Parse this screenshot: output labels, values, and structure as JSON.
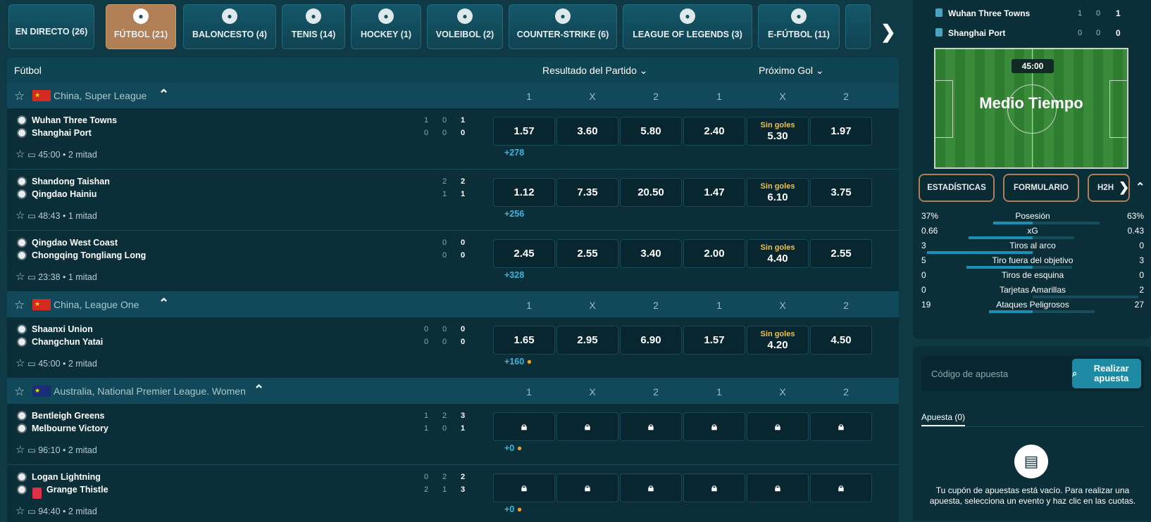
{
  "tabs": [
    {
      "label": "EN DIRECTO (26)",
      "icon": "live-icon"
    },
    {
      "label": "FÚTBOL (21)",
      "icon": "soccer-ball-icon",
      "active": true
    },
    {
      "label": "BALONCESTO (4)",
      "icon": "basketball-icon"
    },
    {
      "label": "TENIS (14)",
      "icon": "tennis-ball-icon"
    },
    {
      "label": "HOCKEY (1)",
      "icon": "hockey-stick-icon"
    },
    {
      "label": "VOLEIBOL (2)",
      "icon": "volleyball-icon"
    },
    {
      "label": "COUNTER-STRIKE (6)",
      "icon": "counter-strike-icon"
    },
    {
      "label": "LEAGUE OF LEGENDS (3)",
      "icon": "league-of-legends-icon"
    },
    {
      "label": "E-FÚTBOL (11)",
      "icon": "efootball-icon"
    }
  ],
  "header": {
    "sport": "Fútbol",
    "market1": "Resultado del Partido",
    "market2": "Próximo Gol"
  },
  "cols": [
    "1",
    "X",
    "2",
    "1",
    "X",
    "2"
  ],
  "leagues": [
    {
      "name": "China, Super League",
      "flag": "cn",
      "events": [
        {
          "home": "Wuhan Three Towns",
          "away": "Shanghai Port",
          "hs": [
            "1",
            "0",
            "1"
          ],
          "as": [
            "0",
            "0",
            "0"
          ],
          "time": "45:00 • 2 mitad",
          "more": "+278",
          "odds": [
            "1.57",
            "3.60",
            "5.80",
            "2.40",
            "5.30",
            "1.97"
          ],
          "sg": "Sin goles"
        },
        {
          "home": "Shandong Taishan",
          "away": "Qingdao Hainiu",
          "hs": [
            "2",
            "2"
          ],
          "as": [
            "1",
            "1"
          ],
          "time": "48:43 • 1 mitad",
          "more": "+256",
          "odds": [
            "1.12",
            "7.35",
            "20.50",
            "1.47",
            "6.10",
            "3.75"
          ],
          "sg": "Sin goles"
        },
        {
          "home": "Qingdao West Coast",
          "away": "Chongqing Tongliang Long",
          "hs": [
            "0",
            "0"
          ],
          "as": [
            "0",
            "0"
          ],
          "time": "23:38 • 1 mitad",
          "more": "+328",
          "odds": [
            "2.45",
            "2.55",
            "3.40",
            "2.00",
            "4.40",
            "2.55"
          ],
          "sg": "Sin goles"
        }
      ]
    },
    {
      "name": "China, League One",
      "flag": "cn",
      "events": [
        {
          "home": "Shaanxi Union",
          "away": "Changchun Yatai",
          "hs": [
            "0",
            "0",
            "0"
          ],
          "as": [
            "0",
            "0",
            "0"
          ],
          "time": "45:00 • 2 mitad",
          "more": "+160",
          "odds": [
            "1.65",
            "2.95",
            "6.90",
            "1.57",
            "4.20",
            "4.50"
          ],
          "sg": "Sin goles"
        }
      ]
    },
    {
      "name": "Australia, National Premier League. Women",
      "flag": "au",
      "events": [
        {
          "home": "Bentleigh Greens",
          "away": "Melbourne Victory",
          "hs": [
            "1",
            "2",
            "3"
          ],
          "as": [
            "1",
            "0",
            "1"
          ],
          "time": "96:10 • 2 mitad",
          "more": "+0"
        },
        {
          "home": "Logan Lightning",
          "away": "Grange Thistle",
          "hs": [
            "0",
            "2",
            "2"
          ],
          "as": [
            "2",
            "1",
            "3"
          ],
          "time": "94:40 • 2 mitad",
          "more": "+0"
        }
      ]
    }
  ],
  "side": {
    "home": "Wuhan Three Towns",
    "away": "Shanghai Port",
    "hs": [
      "1",
      "0",
      "1"
    ],
    "as": [
      "0",
      "0",
      "0"
    ],
    "clock": "45:00",
    "status": "Medio Tiempo",
    "tabs": [
      "ESTADÍSTICAS",
      "FORMULARIO",
      "H2H"
    ],
    "stats": [
      {
        "l": "37%",
        "n": "Posesión",
        "r": "63%",
        "lv": 37,
        "rv": 63
      },
      {
        "l": "0.66",
        "n": "xG",
        "r": "0.43",
        "lv": 0.66,
        "rv": 0.43
      },
      {
        "l": "3",
        "n": "Tiros al arco",
        "r": "0",
        "lv": 3,
        "rv": 0
      },
      {
        "l": "5",
        "n": "Tiro fuera del objetivo",
        "r": "3",
        "lv": 5,
        "rv": 3
      },
      {
        "l": "0",
        "n": "Tiros de esquina",
        "r": "0",
        "lv": 0,
        "rv": 0
      },
      {
        "l": "0",
        "n": "Tarjetas Amarillas",
        "r": "2",
        "lv": 0,
        "rv": 2
      },
      {
        "l": "19",
        "n": "Ataques Peligrosos",
        "r": "27",
        "lv": 19,
        "rv": 27
      }
    ],
    "code_placeholder": "Código de apuesta",
    "code_button": "Realizar apuesta",
    "bet_tab": "Apuesta (0)",
    "empty": "Tu cupón de apuestas está vacío. Para realizar una apuesta, selecciona un evento y haz clic en las cuotas."
  }
}
